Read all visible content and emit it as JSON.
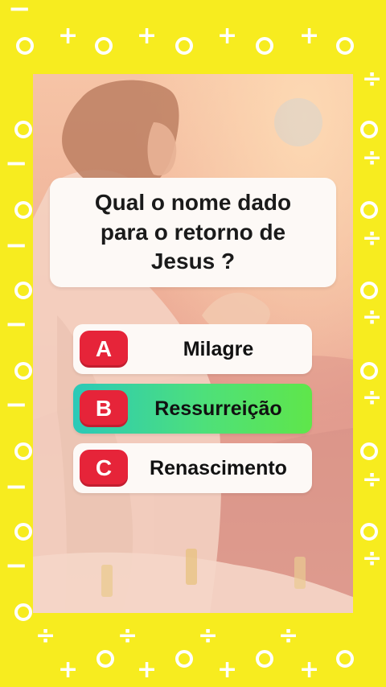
{
  "question": {
    "text": "Qual o nome dado para o retorno de Jesus ?"
  },
  "answers": [
    {
      "letter": "A",
      "label": "Milagre",
      "selected": false
    },
    {
      "letter": "B",
      "label": "Ressurreição",
      "selected": true
    },
    {
      "letter": "C",
      "label": "Renascimento",
      "selected": false
    }
  ],
  "colors": {
    "background": "#f7ec1f",
    "letter_badge": "#e62439",
    "selected_gradient_start": "#2bc9b8",
    "selected_gradient_end": "#5fe64a"
  },
  "background_pattern_icons": [
    "circle-icon",
    "plus-icon",
    "minus-icon",
    "divide-icon"
  ]
}
